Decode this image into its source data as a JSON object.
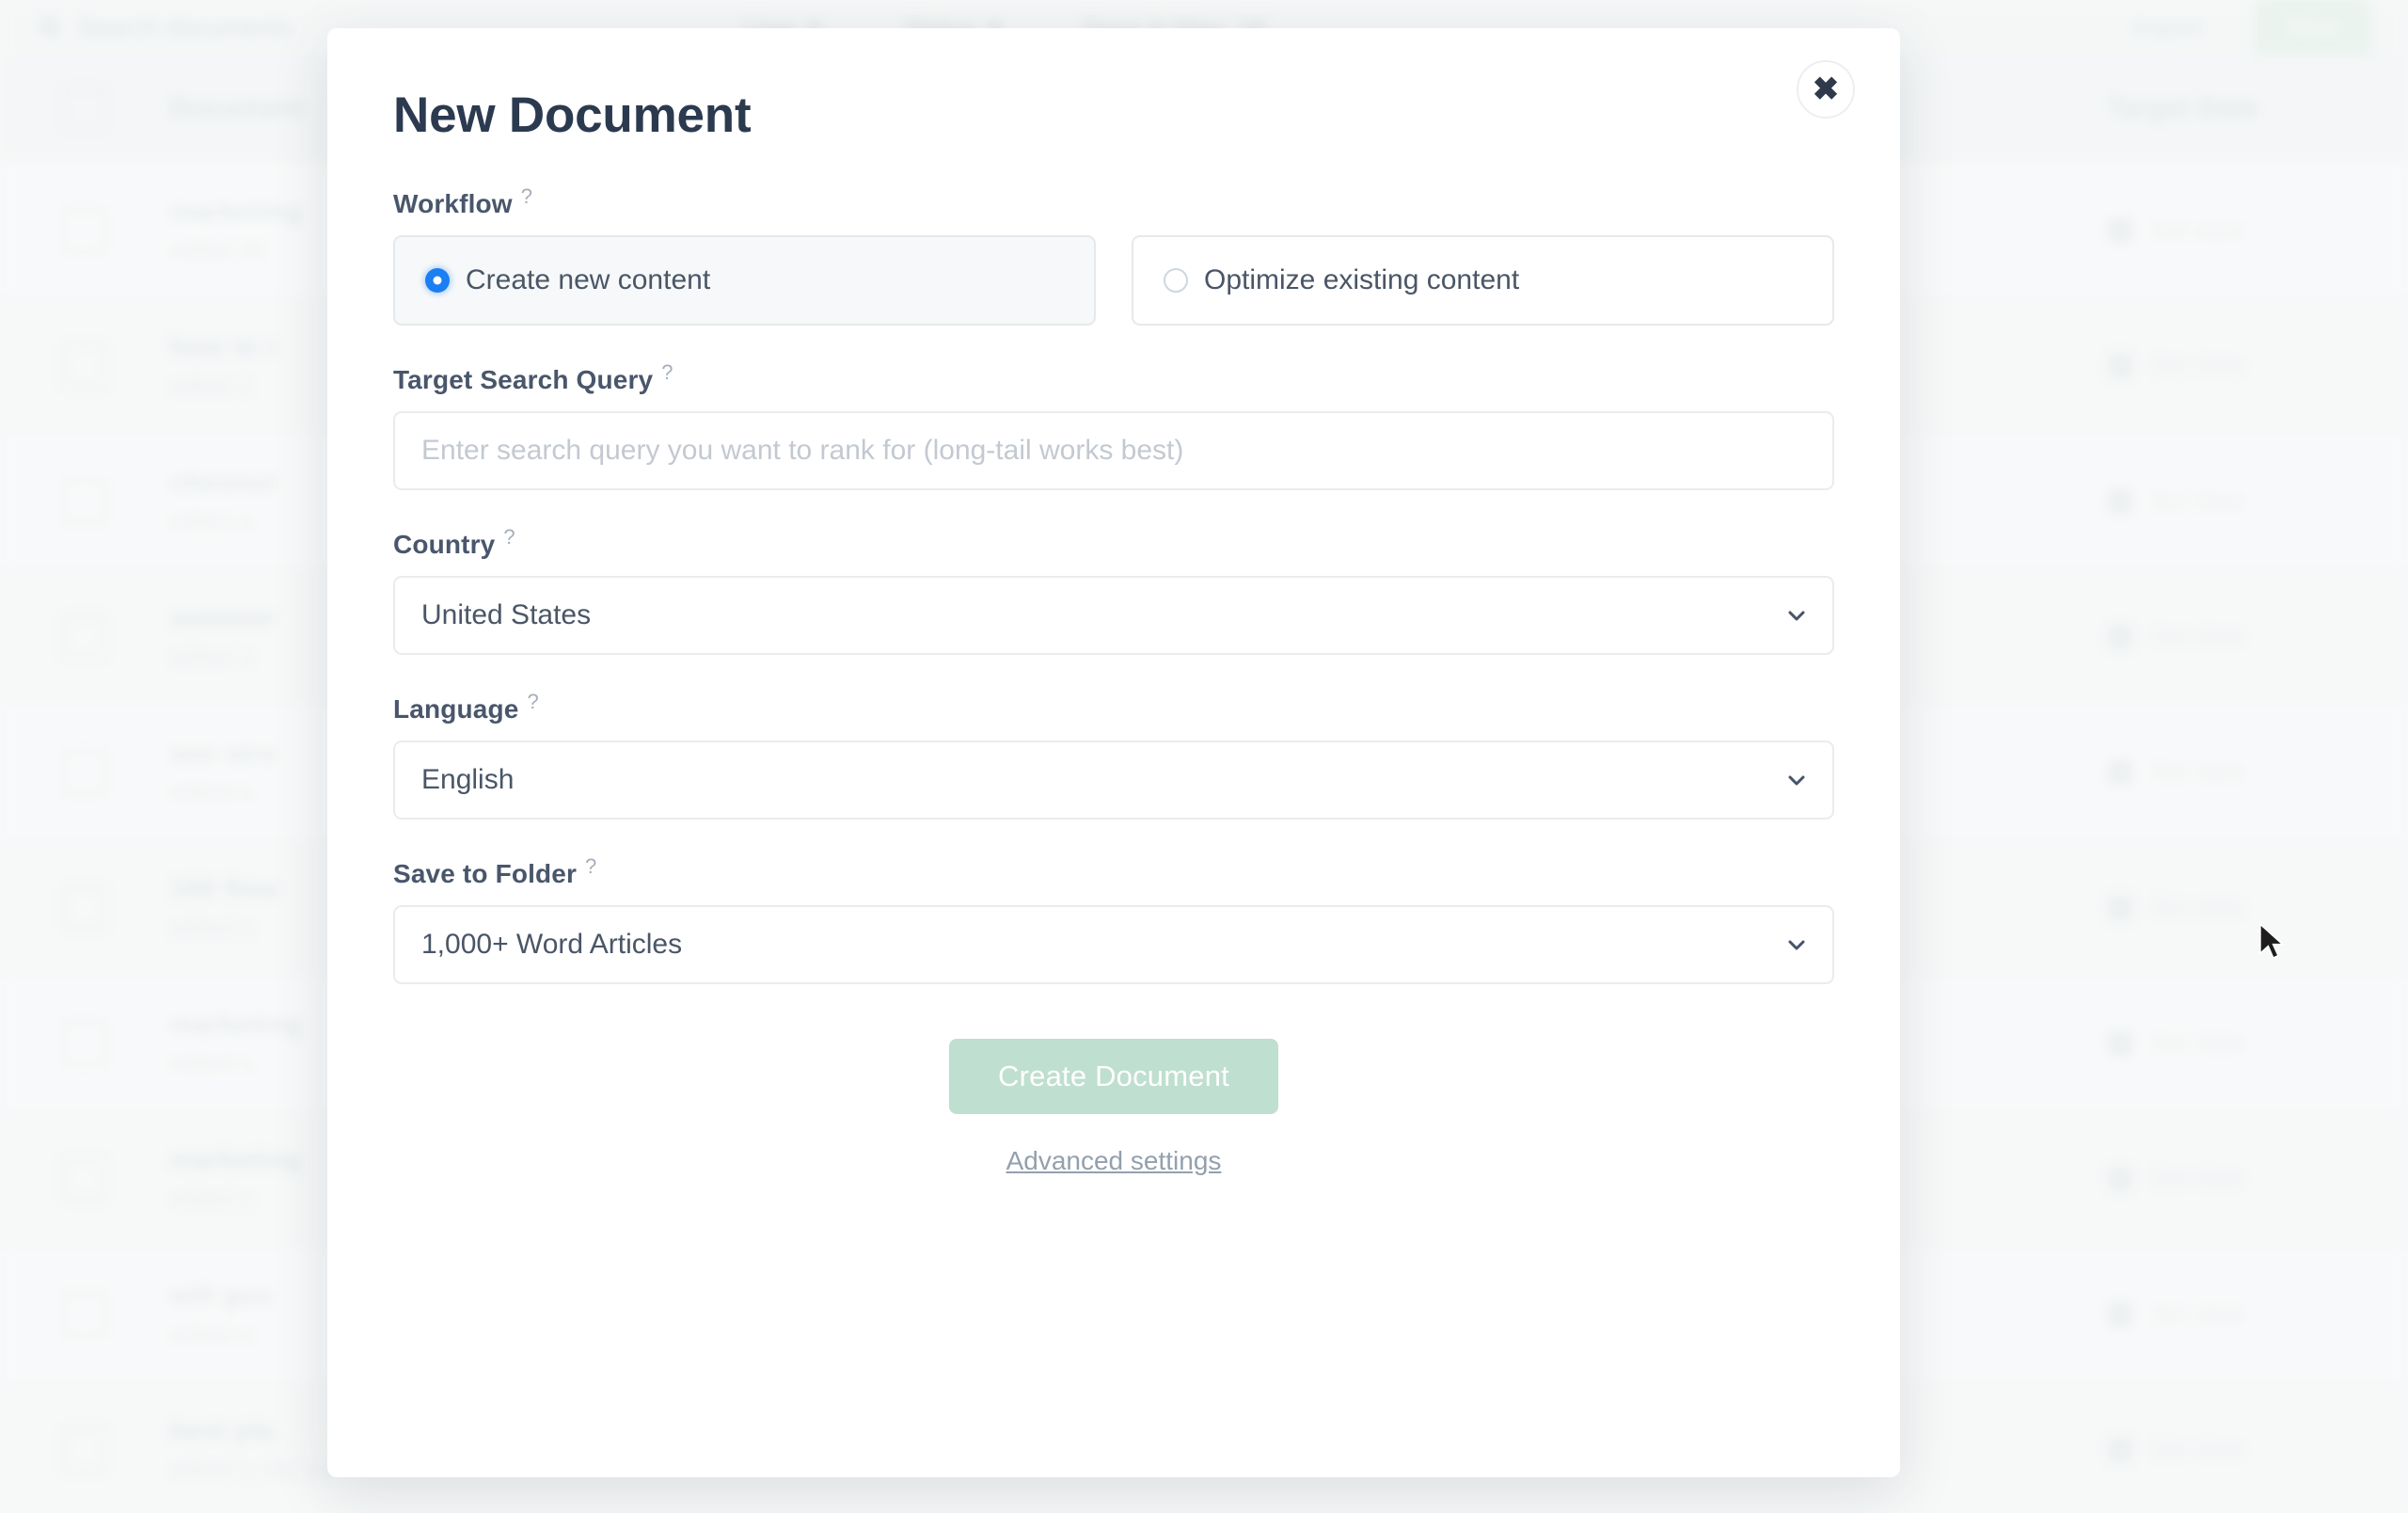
{
  "background": {
    "toolbar": {
      "search_placeholder": "Search documents",
      "search_icon": "search-icon",
      "filters": [
        {
          "label": "User",
          "icon": "chevron-down-icon"
        },
        {
          "label": "Status",
          "icon": "chevron-down-icon"
        }
      ],
      "docs_count_label": "Docs in May: 18",
      "import_label": "Import",
      "new_label": "New"
    },
    "table": {
      "columns": {
        "document": "Document",
        "target_date": "Target Date"
      },
      "rows": [
        {
          "title": "marketing",
          "subtitle": "edited 30",
          "date": "Set date"
        },
        {
          "title": "how to t",
          "subtitle": "edited 1",
          "date": "Set date"
        },
        {
          "title": "chesnut",
          "subtitle": "edited a",
          "date": "Set date"
        },
        {
          "title": "summer",
          "subtitle": "edited a",
          "date": "Set date"
        },
        {
          "title": "seo stra",
          "subtitle": "edited a",
          "date": "Set date"
        },
        {
          "title": "100 flow",
          "subtitle": "edited a",
          "date": "Set date"
        },
        {
          "title": "marketing",
          "subtitle": "edited a",
          "date": "Set date"
        },
        {
          "title": "marketing",
          "subtitle": "edited a",
          "date": "Set date"
        },
        {
          "title": "will goo",
          "subtitle": "edited a",
          "date": "Set date"
        },
        {
          "title": "best pla",
          "subtitle": "edited a day ago",
          "date": "Set date"
        }
      ],
      "date_icon": "calendar-icon"
    }
  },
  "modal": {
    "title": "New Document",
    "close_icon": "close-icon",
    "help_marker": "?",
    "workflow": {
      "label": "Workflow",
      "options": [
        {
          "label": "Create new content",
          "selected": true
        },
        {
          "label": "Optimize existing content",
          "selected": false
        }
      ]
    },
    "target_search_query": {
      "label": "Target Search Query",
      "value": "",
      "placeholder": "Enter search query you want to rank for (long-tail works best)"
    },
    "country": {
      "label": "Country",
      "value": "United States",
      "chevron_icon": "chevron-down-icon"
    },
    "language": {
      "label": "Language",
      "value": "English",
      "chevron_icon": "chevron-down-icon"
    },
    "save_to_folder": {
      "label": "Save to Folder",
      "value": "1,000+ Word Articles",
      "chevron_icon": "chevron-down-icon"
    },
    "submit": {
      "label": "Create Document",
      "disabled": true,
      "color": "#bfdfd0"
    },
    "advanced_link": "Advanced settings"
  },
  "pointer": {
    "icon": "mouse-cursor"
  },
  "colors": {
    "title": "#2b3a4f",
    "radio_selected": "#1b7ef2",
    "submit_bg": "#bfdfd0",
    "border": "#e9ecef"
  }
}
